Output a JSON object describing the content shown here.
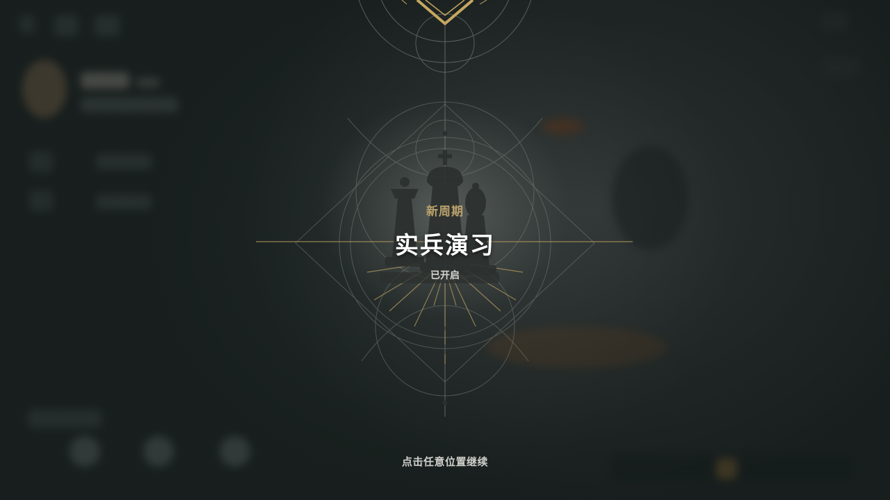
{
  "banner": {
    "subtitle": "新周期",
    "title": "实兵演习",
    "status": "已开启"
  },
  "continue_hint": "点击任意位置继续",
  "icons": {
    "emblem": "chess-pieces-icon",
    "top_crest": "crest-chevron-icon"
  },
  "colors": {
    "accent_gold": "#b9a06a",
    "title_white": "#ffffff",
    "background": "#1a2120"
  }
}
